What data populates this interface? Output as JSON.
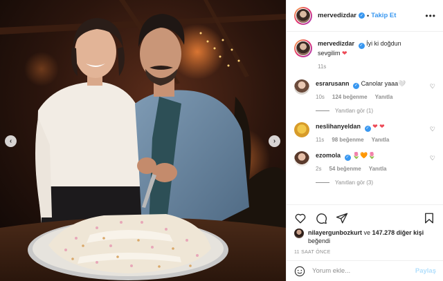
{
  "header": {
    "username": "mervedizdar",
    "separator": "•",
    "follow_label": "Takip Et",
    "more_label": "•••"
  },
  "caption": {
    "username": "mervedizdar",
    "text": "İyi ki doğdun sevgilim",
    "emoji": "❤",
    "time": "11s"
  },
  "comments": [
    {
      "username": "esrarusann",
      "text": "Canolar yaaa🤍",
      "time": "10s",
      "likes": "124 beğenme",
      "reply": "Yanıtla",
      "view_replies": "Yanıtları gör (1)"
    },
    {
      "username": "neslihanyeldan",
      "text": "❤ ❤",
      "time": "11s",
      "likes": "98 beğenme",
      "reply": "Yanıtla",
      "view_replies": ""
    },
    {
      "username": "ezomola",
      "text": "🌷🧡🌷",
      "time": "2s",
      "likes": "54 beğenme",
      "reply": "Yanıtla",
      "view_replies": "Yanıtları gör (3)"
    }
  ],
  "likes": {
    "user": "nilayergunbozkurt",
    "connector": "ve",
    "count": "147.278",
    "rest": "diğer kişi",
    "verb": "beğendi"
  },
  "time_ago": "11 SAAT ÖNCE",
  "composer": {
    "placeholder": "Yorum ekle...",
    "post_label": "Paylaş"
  },
  "media": {
    "prev_label": "‹",
    "next_label": "›"
  },
  "colors": {
    "accent": "#3897f0",
    "heart": "#ed4956",
    "muted": "#8e8e8e",
    "post_disabled": "#b2dffc"
  }
}
